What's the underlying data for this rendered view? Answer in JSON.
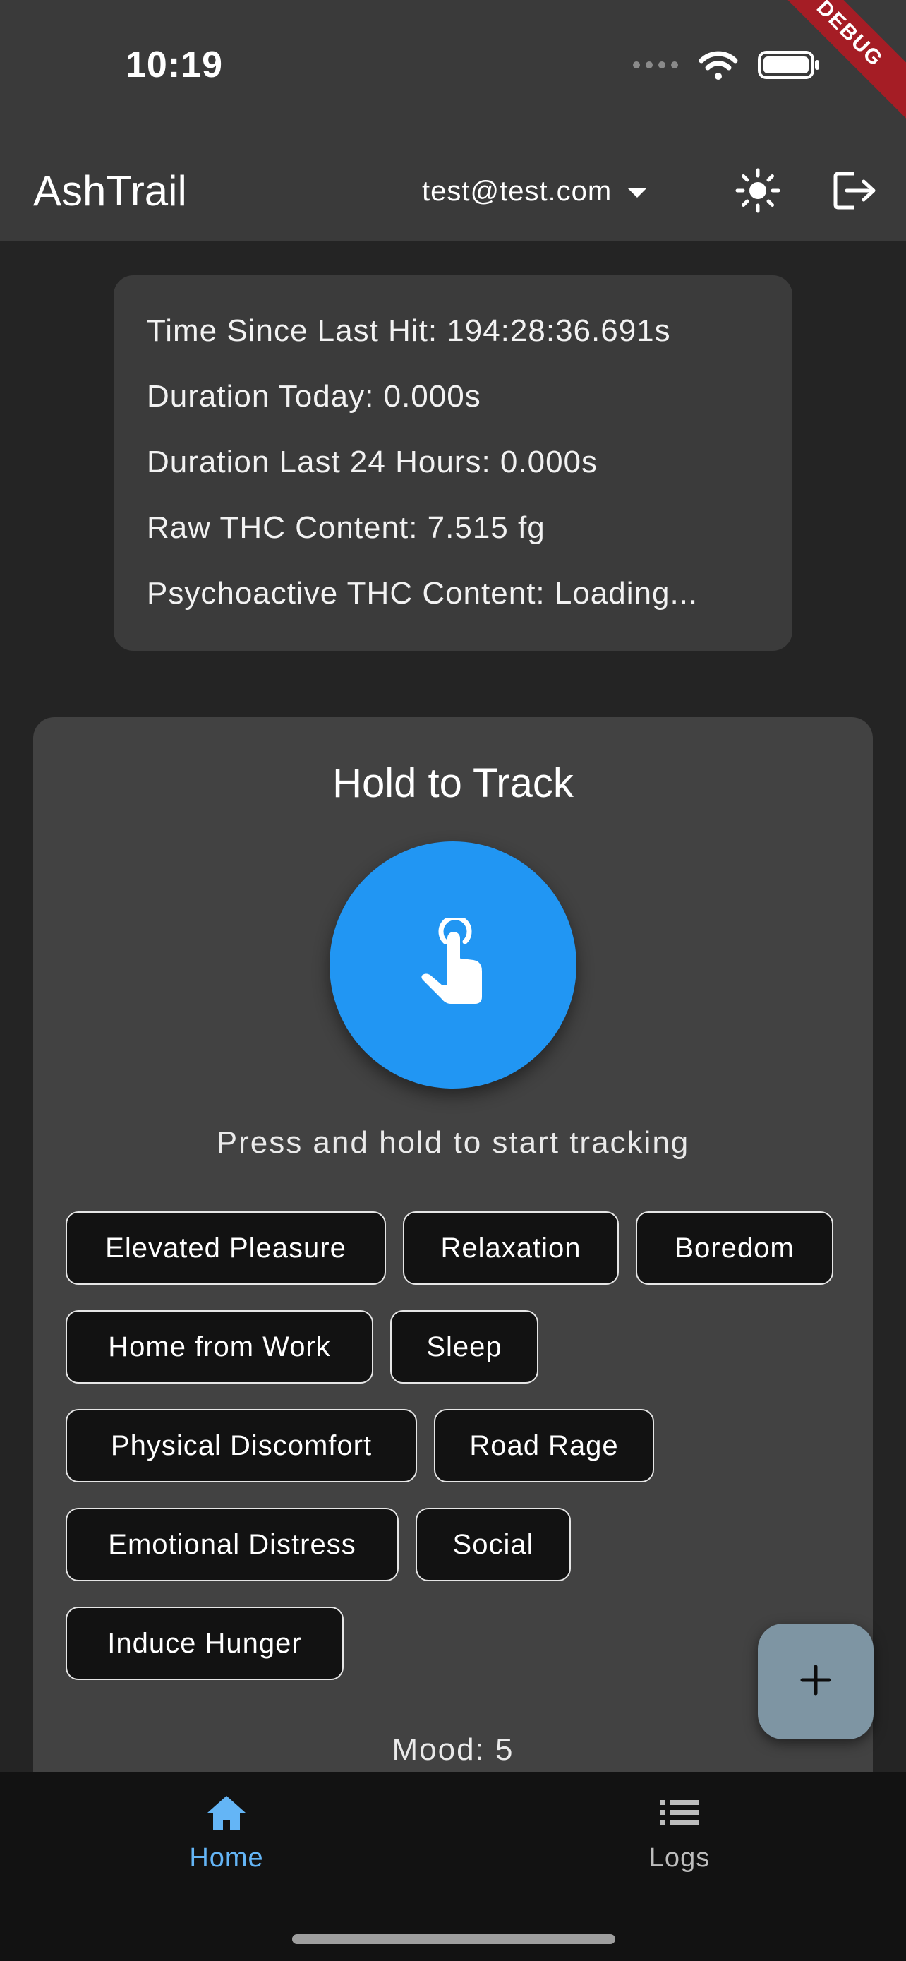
{
  "status_bar": {
    "time": "10:19",
    "icons": [
      "signal-dots-icon",
      "wifi-icon",
      "battery-icon"
    ],
    "debug_banner": "DEBUG"
  },
  "app_bar": {
    "title": "AshTrail",
    "account": "test@test.com",
    "actions": [
      "theme-toggle-sun-icon",
      "logout-icon"
    ]
  },
  "stats": {
    "time_since_last_hit": "Time Since Last Hit: 194:28:36.691s",
    "duration_today": "Duration Today: 0.000s",
    "duration_last_24h": "Duration Last 24 Hours: 0.000s",
    "raw_thc": "Raw THC Content: 7.515 fg",
    "psychoactive_thc": "Psychoactive THC Content: Loading..."
  },
  "tracker": {
    "title": "Hold to Track",
    "button_icon": "touch-hand-icon",
    "hint": "Press and hold to start tracking",
    "reasons": [
      "Elevated Pleasure",
      "Relaxation",
      "Boredom",
      "Home from Work",
      "Sleep",
      "Physical Discomfort",
      "Road Rage",
      "Emotional Distress",
      "Social",
      "Induce Hunger"
    ],
    "mood_label": "Mood: 5"
  },
  "fab": {
    "icon": "plus-icon"
  },
  "bottom_nav": {
    "items": [
      {
        "label": "Home",
        "icon": "home-icon",
        "active": true
      },
      {
        "label": "Logs",
        "icon": "list-icon",
        "active": false
      }
    ],
    "active_color": "#64b5f6",
    "inactive_color": "#bdbdbd"
  },
  "colors": {
    "accent": "#2196f3",
    "app_bar": "#3a3a3a",
    "background": "#242424",
    "card": "#424242",
    "debug": "#a51d25"
  }
}
